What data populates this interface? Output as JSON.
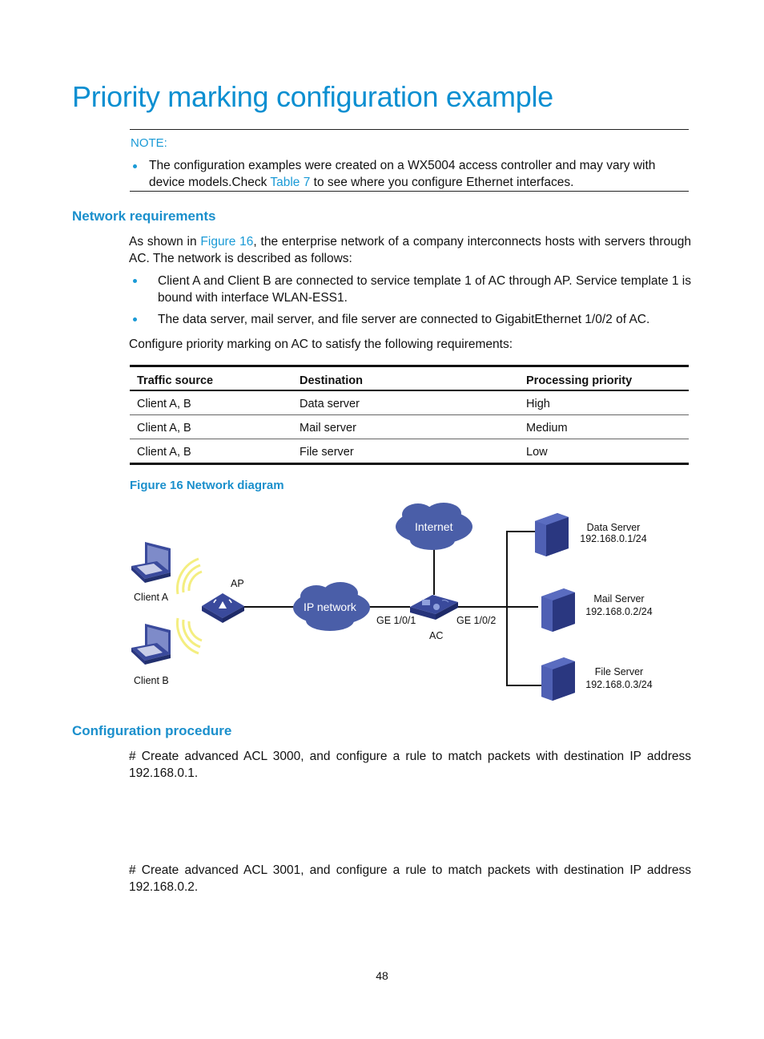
{
  "page": {
    "title": "Priority marking configuration example",
    "page_number": "48"
  },
  "note": {
    "label": "NOTE:",
    "text_before_link": "The configuration examples were created on a WX5004 access controller and may vary with device models.Check ",
    "link_text": "Table 7",
    "text_after_link": " to see where you configure Ethernet interfaces."
  },
  "network_requirements": {
    "heading": "Network requirements",
    "intro_before_link": "As shown in ",
    "intro_link": "Figure 16",
    "intro_after_link": ", the enterprise network of a company interconnects hosts with servers through AC. The network is described as follows:",
    "bullets": [
      "Client A and Client B are connected to service template 1 of AC through AP. Service template 1 is bound with interface WLAN-ESS1.",
      "The data server, mail server, and file server are connected to GigabitEthernet 1/0/2 of AC."
    ],
    "lead_in": "Configure priority marking on AC to satisfy the following requirements:"
  },
  "table": {
    "headers": [
      "Traffic source",
      "Destination",
      "Processing priority"
    ],
    "rows": [
      [
        "Client A, B",
        "Data server",
        "High"
      ],
      [
        "Client A, B",
        "Mail server",
        "Medium"
      ],
      [
        "Client A, B",
        "File server",
        "Low"
      ]
    ]
  },
  "figure": {
    "caption": "Figure 16 Network diagram",
    "labels": {
      "client_a": "Client A",
      "client_b": "Client B",
      "ap": "AP",
      "ip_network": "IP network",
      "internet": "Internet",
      "ac": "AC",
      "ge_1": "GE 1/0/1",
      "ge_2": "GE 1/0/2",
      "data_server": "Data Server",
      "data_server_ip": "192.168.0.1/24",
      "mail_server": "Mail Server",
      "mail_server_ip": "192.168.0.2/24",
      "file_server": "File Server",
      "file_server_ip": "192.168.0.3/24"
    },
    "colors": {
      "device_blue": "#3a4a9c",
      "cloud_blue": "#4a5ea8",
      "wireless_yellow": "#f7f07a"
    }
  },
  "configuration_procedure": {
    "heading": "Configuration procedure",
    "steps": [
      "# Create advanced ACL 3000, and configure a rule to match packets with destination IP address 192.168.0.1.",
      "# Create advanced ACL 3001, and configure a rule to match packets with destination IP address 192.168.0.2."
    ]
  }
}
